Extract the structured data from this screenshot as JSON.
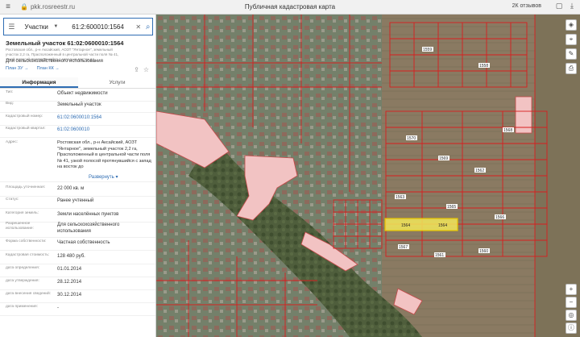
{
  "browser": {
    "url": "pkk.rosreestr.ru",
    "title": "Публичная кадастровая карта",
    "reviews": "2К отзывов"
  },
  "search": {
    "type_label": "Участки",
    "query": "61:2:600010:1564"
  },
  "object": {
    "title": "Земельный участок 61:02:0600010:1564",
    "address": "Ростовская обл., р-н Аксайский, АОЗТ \"Янтарное\", земельный участок 2,2 га, Прасположенный в центральной части поля № 41, узкой полосой протянувшийся с запад на восток до",
    "purpose": "Для сельскохозяйственного использования",
    "plan_zu": "План ЗУ →",
    "plan_kk": "План КК →"
  },
  "tabs": [
    {
      "label": "Информация",
      "active": true
    },
    {
      "label": "Услуги",
      "active": false
    }
  ],
  "info_rows": [
    {
      "label": "Тип:",
      "value": "Объект недвижимости"
    },
    {
      "label": "Вид:",
      "value": "Земельный участок"
    },
    {
      "label": "Кадастровый номер:",
      "value": "61:02:0600010:1564",
      "link": true
    },
    {
      "label": "Кадастровый квартал:",
      "value": "61:02:0600010",
      "link": true
    },
    {
      "label": "Адрес:",
      "value": "Ростовская обл., р-н Аксайский, АОЗТ \"Янтарное\", земельный участок 2,2 га, Прасположенный в центральной части поля № 41, узкой полосой протянувшийся с запад на восток до"
    },
    {
      "label": "Площадь уточненная:",
      "value": "22 000 кв. м"
    },
    {
      "label": "Статус:",
      "value": "Ранее учтенный"
    },
    {
      "label": "Категория земель:",
      "value": "Земли населённых пунктов"
    },
    {
      "label": "Разрешенное использование:",
      "value": "Для сельскохозяйственного использования"
    },
    {
      "label": "Форма собственности:",
      "value": "Частная собственность"
    },
    {
      "label": "Кадастровая стоимость:",
      "value": "128 480 руб."
    },
    {
      "label": "дата определения:",
      "value": "01.01.2014"
    },
    {
      "label": "дата утверждения:",
      "value": "28.12.2014"
    },
    {
      "label": "дата внесения сведений:",
      "value": "30.12.2014"
    },
    {
      "label": "дата применения:",
      "value": "-"
    }
  ],
  "expand_label": "Развернуть ▾",
  "map": {
    "highlight_labels": [
      "1564",
      "1564"
    ],
    "parcel_numbers": [
      "1563",
      "1565",
      "1566",
      "1567",
      "1561",
      "1560",
      "1562",
      "1569",
      "1570",
      "1568",
      "1559",
      "1558",
      "1557",
      "1571",
      "1556",
      "1555",
      "1554",
      "1553",
      "1572",
      "1573",
      "1552",
      "1551"
    ],
    "colors": {
      "highlight": "#f2e85a",
      "boundary": "#d81f1f",
      "zone": "#f2c3c3"
    }
  }
}
